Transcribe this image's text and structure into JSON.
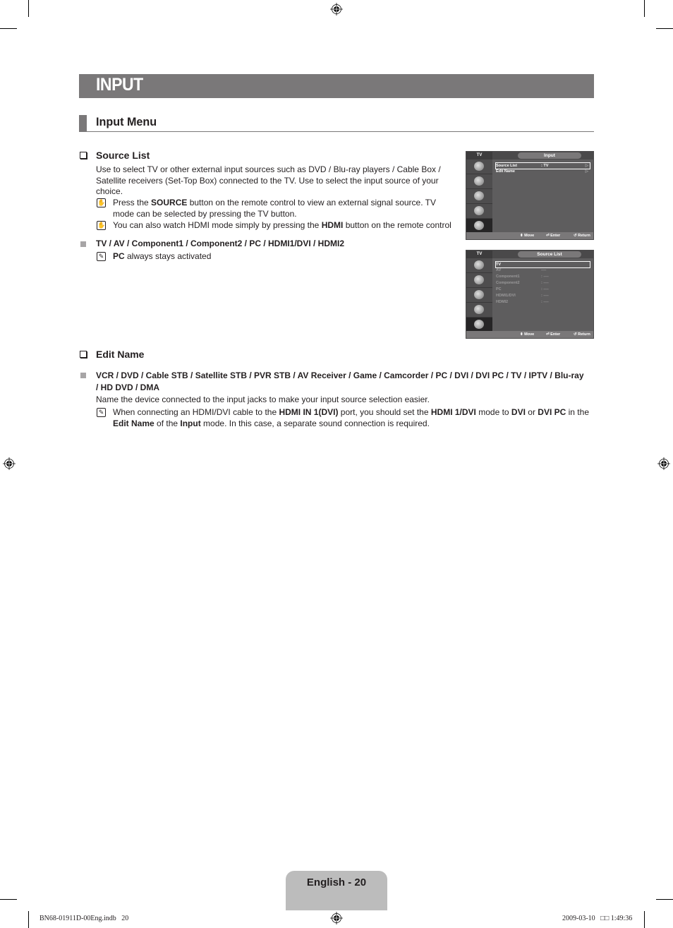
{
  "page_title": "INPUT",
  "section_title": "Input Menu",
  "source_list": {
    "heading": "Source List",
    "description": "Use to select TV or other external input sources such as DVD / Blu-ray players / Cable Box / Satellite receivers (Set-Top Box) connected to the TV. Use to select the input source of your choice.",
    "notes": [
      {
        "pre": "Press the ",
        "bold": "SOURCE",
        "post": " button on the remote control to view an external signal source. TV mode can be selected by pressing the TV button."
      },
      {
        "pre": "You can also watch HDMI mode simply by pressing the ",
        "bold": "HDMI",
        "post": " button on the remote control"
      }
    ],
    "options_line": "TV / AV / Component1 / Component2 / PC / HDMI1/DVI / HDMI2",
    "options_note": {
      "bold": "PC",
      "post": " always stays activated"
    }
  },
  "edit_name": {
    "heading": "Edit Name",
    "options_line_1": "VCR / DVD / Cable STB / Satellite STB / PVR STB / AV Receiver / Game / Camcorder / PC / DVI / DVI PC / TV / IPTV / Blu-ray",
    "options_line_2": "/ HD DVD / DMA",
    "description": "Name the device connected to the input jacks to make your input source selection easier.",
    "note": {
      "t1": "When connecting an HDMI/DVI cable to the ",
      "b1": "HDMI IN 1(DVI)",
      "t2": " port, you should set the ",
      "b2": "HDMI 1/DVI",
      "t3": " mode to ",
      "b3": "DVI",
      "t4": " or ",
      "b4": "DVI PC",
      "t5": " in the ",
      "b5": "Edit Name",
      "t6": " of the ",
      "b6": "Input",
      "t7": " mode. In this case, a separate sound connection is required."
    }
  },
  "osd_input": {
    "tab": "TV",
    "title": "Input",
    "rows": [
      {
        "label": "Source List",
        "value": ": TV",
        "arrow": "▷"
      },
      {
        "label": "Edit Name",
        "value": "",
        "arrow": "▷"
      }
    ],
    "footer": {
      "move": "Move",
      "enter": "Enter",
      "return": "Return"
    }
  },
  "osd_source": {
    "tab": "TV",
    "title": "Source List",
    "rows": [
      {
        "label": "TV",
        "value": ""
      },
      {
        "label": "AV",
        "value": "----"
      },
      {
        "label": "Component1",
        "value": ": ----"
      },
      {
        "label": "Component2",
        "value": ": ----"
      },
      {
        "label": "PC",
        "value": ": ----"
      },
      {
        "label": "HDMI1/DVI",
        "value": ": ----"
      },
      {
        "label": "HDMI2",
        "value": ": ----"
      }
    ],
    "footer": {
      "move": "Move",
      "enter": "Enter",
      "return": "Return"
    }
  },
  "page_number": "English - 20",
  "slug_left": "BN68-01911D-00Eng.indb   20",
  "slug_right": "2009-03-10   □□ 1:49:36"
}
